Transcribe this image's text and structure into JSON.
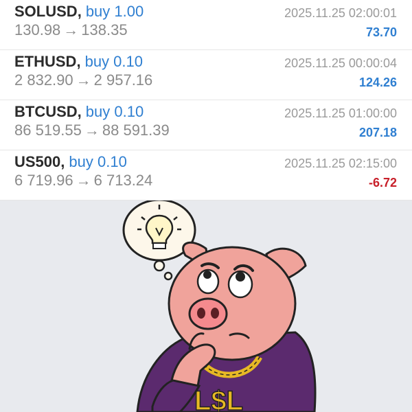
{
  "trades": [
    {
      "symbol": "SOLUSD",
      "side": "buy 1.00",
      "open_price": "130.98",
      "close_price": "138.35",
      "time": "2025.11.25 02:00:01",
      "profit": "73.70",
      "profit_positive": true
    },
    {
      "symbol": "ETHUSD",
      "side": "buy 0.10",
      "open_price": "2 832.90",
      "close_price": "2 957.16",
      "time": "2025.11.25 00:00:04",
      "profit": "124.26",
      "profit_positive": true
    },
    {
      "symbol": "BTCUSD",
      "side": "buy 0.10",
      "open_price": "86 519.55",
      "close_price": "88 591.39",
      "time": "2025.11.25 01:00:00",
      "profit": "207.18",
      "profit_positive": true
    },
    {
      "symbol": "US500",
      "side": "buy 0.10",
      "open_price": "6 719.96",
      "close_price": "6 713.24",
      "time": "2025.11.25 02:15:00",
      "profit": "-6.72",
      "profit_positive": false
    }
  ],
  "arrow_glyph": "→",
  "illustration": {
    "chain_pendant_text": "L$L",
    "colors": {
      "positive": "#2f7fd1",
      "negative": "#c8202a",
      "pig": "#f0a39b",
      "hoodie": "#5b2a6e",
      "gold": "#e7b825",
      "background": "#e8eaee"
    }
  }
}
